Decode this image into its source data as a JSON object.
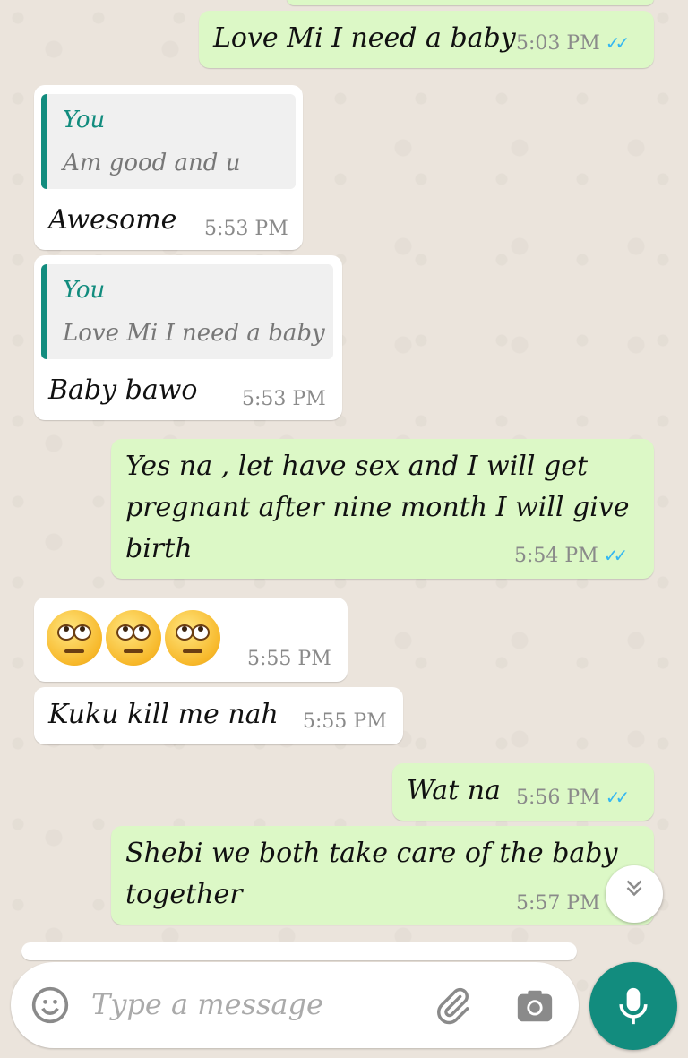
{
  "messages": [
    {
      "text": "Love Mi I need a baby",
      "time": "5:03 PM",
      "ticks": "✓✓"
    },
    {
      "quote_author": "You",
      "quote_text": "Am good and u",
      "text": "Awesome",
      "time": "5:53 PM"
    },
    {
      "quote_author": "You",
      "quote_text": "Love Mi I need a baby",
      "text": "Baby bawo",
      "time": "5:53 PM"
    },
    {
      "text_line1": "Yes na , let have sex and I will get",
      "text_line2": "pregnant after nine month  I will give",
      "text_line3": "birth",
      "time": "5:54 PM",
      "ticks": "✓✓"
    },
    {
      "emoji": "🙄🙄🙄",
      "time": "5:55 PM"
    },
    {
      "text": "Kuku kill me nah",
      "time": "5:55 PM"
    },
    {
      "text": "Wat na",
      "time": "5:56 PM",
      "ticks": "✓✓"
    },
    {
      "text_line1": "Shebi we both take care of the baby",
      "text_line2": "together",
      "time": "5:57 PM"
    }
  ],
  "composer": {
    "placeholder": "Type a message"
  },
  "icons": {
    "emoji": "smiley-icon",
    "attach": "paperclip-icon",
    "camera": "camera-icon",
    "mic": "microphone-icon",
    "scroll": "double-chevron-down-icon"
  },
  "colors": {
    "outgoing_bubble": "#dcf8c6",
    "incoming_bubble": "#ffffff",
    "accent": "#128c7e",
    "read_ticks": "#34b7f1"
  }
}
